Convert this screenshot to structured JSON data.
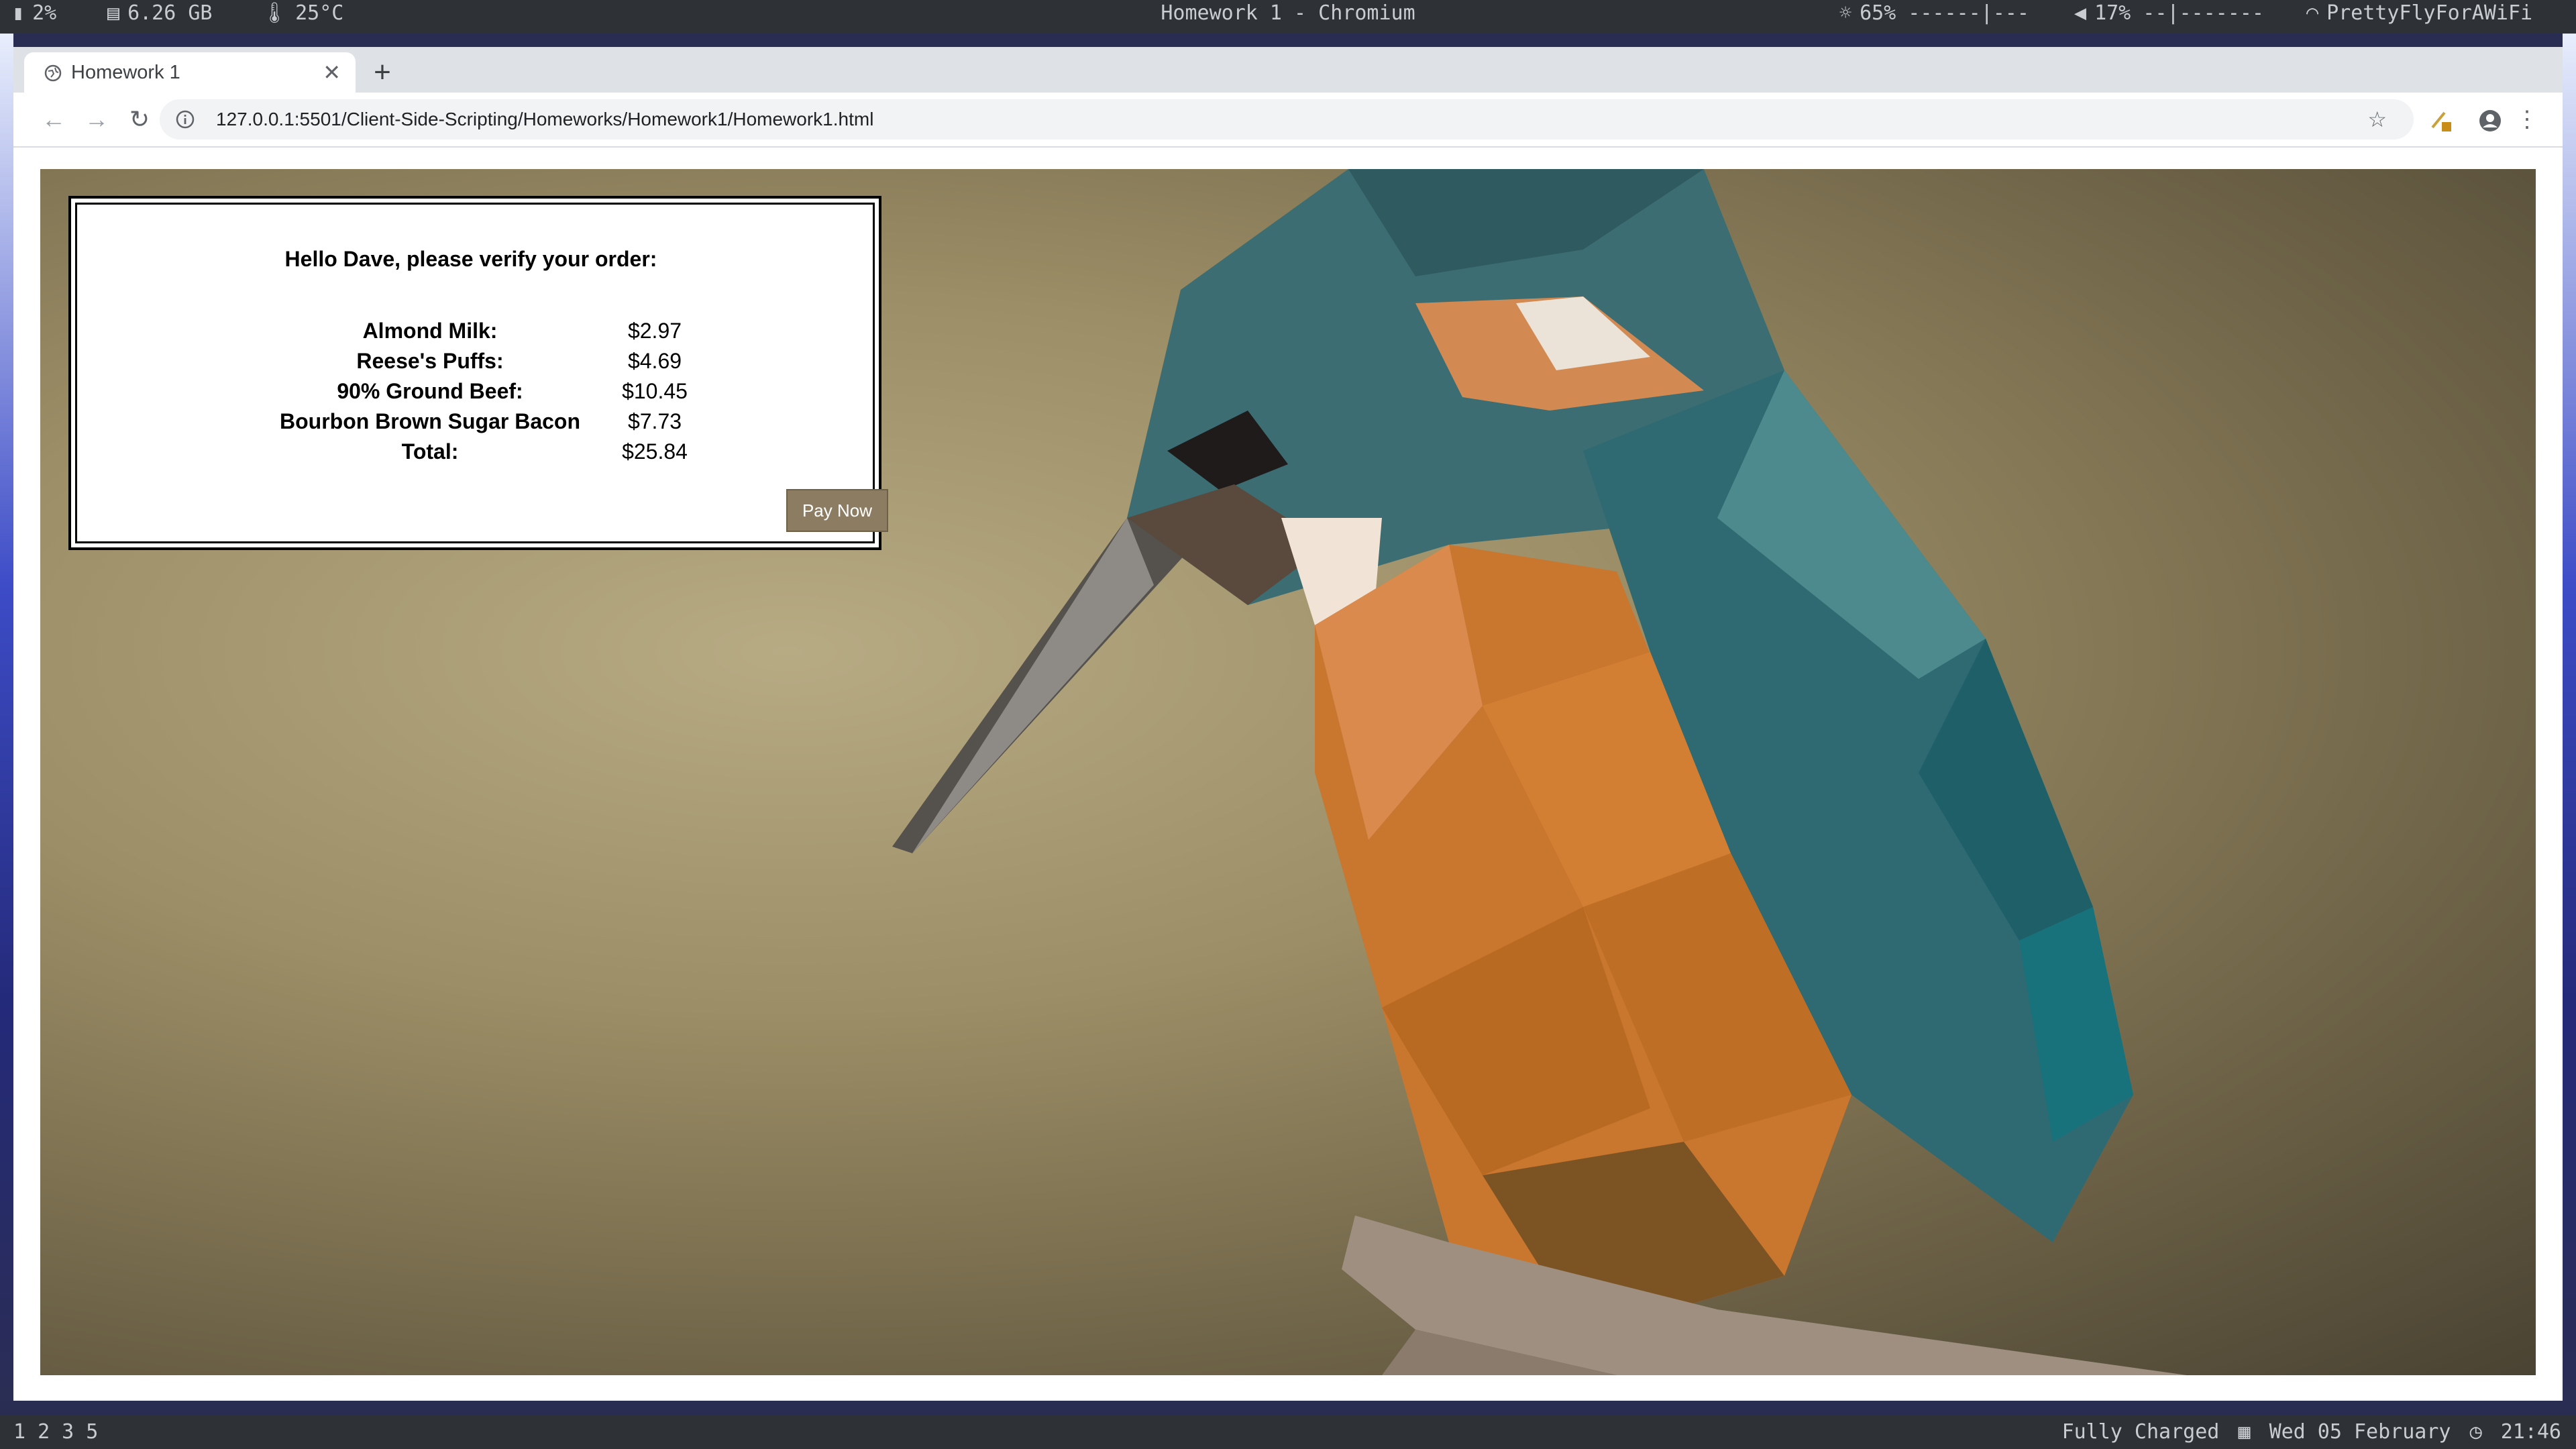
{
  "system_bar": {
    "battery": "2%",
    "memory": "6.26 GB",
    "temperature": "25°C",
    "window_title": "Homework 1 - Chromium",
    "brightness": "65% ------|---",
    "volume": "17% --|-------",
    "wifi": "PrettyFlyForAWiFi"
  },
  "browser": {
    "tab_title": "Homework 1",
    "tab_close": "✕",
    "new_tab": "+",
    "url": "127.0.0.1:5501/Client-Side-Scripting/Homeworks/Homework1/Homework1.html"
  },
  "order": {
    "greeting": "Hello Dave, please verify your order:",
    "items": [
      {
        "name": "Almond Milk:",
        "price": "$2.97"
      },
      {
        "name": "Reese's Puffs:",
        "price": "$4.69"
      },
      {
        "name": "90% Ground Beef:",
        "price": "$10.45"
      },
      {
        "name": "Bourbon Brown Sugar Bacon",
        "price": "$7.73"
      },
      {
        "name": "Total:",
        "price": "$25.84"
      }
    ],
    "pay_button": "Pay Now"
  },
  "status_bar": {
    "workspaces": [
      "1",
      "2",
      "3",
      "5"
    ],
    "battery_status": "Fully Charged",
    "date": "Wed 05 February",
    "time": "21:46"
  },
  "colors": {
    "pay_button_bg": "#8c7d62",
    "chrome_bg": "#dee1e6"
  }
}
